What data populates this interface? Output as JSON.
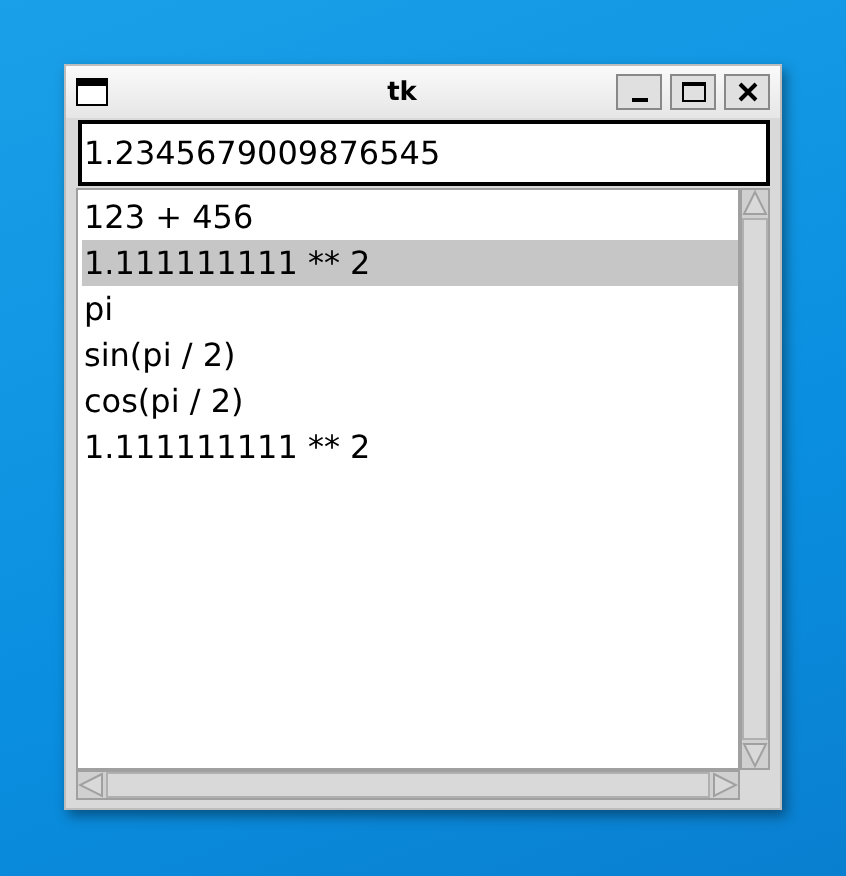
{
  "window": {
    "title": "tk"
  },
  "entry": {
    "value": "1.2345679009876545"
  },
  "listbox": {
    "items": [
      {
        "text": "123 + 456",
        "selected": false
      },
      {
        "text": "1.111111111 ** 2",
        "selected": true
      },
      {
        "text": "pi",
        "selected": false
      },
      {
        "text": "sin(pi / 2)",
        "selected": false
      },
      {
        "text": "cos(pi / 2)",
        "selected": false
      },
      {
        "text": "1.111111111 ** 2",
        "selected": false
      }
    ]
  }
}
